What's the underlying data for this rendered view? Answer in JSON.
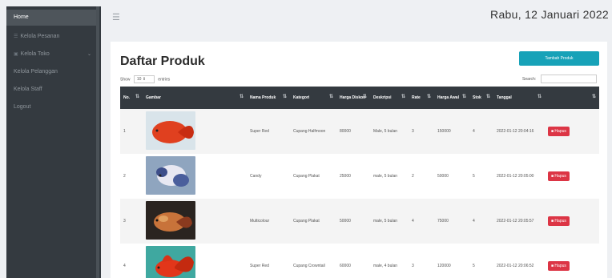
{
  "sidebar": {
    "items": [
      {
        "label": "Home",
        "icon": ""
      },
      {
        "label": "Kelola Pesanan",
        "icon": "cart-icon"
      },
      {
        "label": "Kelola Toko",
        "icon": "store-icon"
      },
      {
        "label": "Kelola Pelanggan",
        "icon": ""
      },
      {
        "label": "Kelola Staff",
        "icon": ""
      },
      {
        "label": "Logout",
        "icon": ""
      }
    ]
  },
  "header": {
    "date": "Rabu, 12 Januari 2022"
  },
  "main": {
    "title": "Daftar Produk",
    "add_button": "Tambah Produk",
    "show_label": "Show",
    "entries_value": "10",
    "entries_label": "entries",
    "search_label": "Search:"
  },
  "table": {
    "columns": [
      "No.",
      "Gambar",
      "Nama Produk",
      "Kategori",
      "Harga Diskon",
      "Deskripsi",
      "Rate",
      "Harga Awal",
      "Stok",
      "Tanggal",
      ""
    ],
    "rows": [
      {
        "no": "1",
        "nama": "Super Red",
        "kategori": "Cupang Halfmoon",
        "harga_diskon": "80000",
        "deskripsi": "Male, 5 bulan",
        "rate": "3",
        "harga_awal": "150000",
        "stok": "4",
        "tanggal": "2022-01-12 20:04:16",
        "aksi": "Hapus"
      },
      {
        "no": "2",
        "nama": "Candy",
        "kategori": "Cupang Plakat",
        "harga_diskon": "25000",
        "deskripsi": "male, 5 bulan",
        "rate": "2",
        "harga_awal": "50000",
        "stok": "5",
        "tanggal": "2022-01-12 20:05:00",
        "aksi": "Hapus"
      },
      {
        "no": "3",
        "nama": "Multicolour",
        "kategori": "Cupang Plakat",
        "harga_diskon": "50000",
        "deskripsi": "male, 5 bulan",
        "rate": "4",
        "harga_awal": "75000",
        "stok": "4",
        "tanggal": "2022-01-12 20:05:57",
        "aksi": "Hapus"
      },
      {
        "no": "4",
        "nama": "Super Red",
        "kategori": "Cupang Crowntail",
        "harga_diskon": "60000",
        "deskripsi": "male, 4 bulan",
        "rate": "3",
        "harga_awal": "120000",
        "stok": "5",
        "tanggal": "2022-01-12 20:06:52",
        "aksi": "Hapus"
      }
    ]
  },
  "colors": {
    "sidebar": "#343a40",
    "accent": "#17a2b8",
    "danger": "#dc3545"
  }
}
